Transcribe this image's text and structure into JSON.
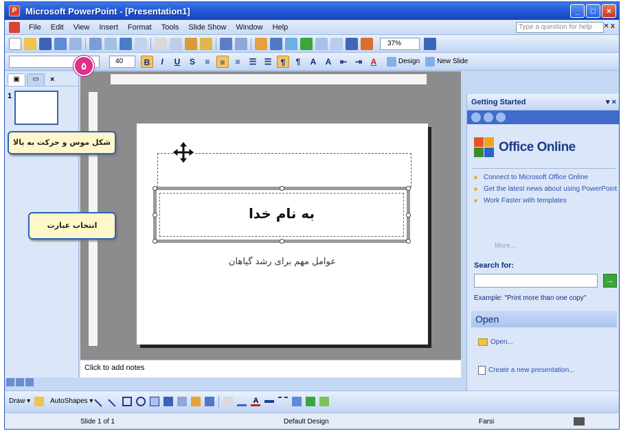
{
  "window": {
    "title": "Microsoft PowerPoint - [Presentation1]",
    "app_icon_letter": "P"
  },
  "menubar": {
    "items": [
      "File",
      "Edit",
      "View",
      "Insert",
      "Format",
      "Tools",
      "Slide Show",
      "Window",
      "Help"
    ],
    "help_placeholder": "Type a question for help",
    "close_label": "× x"
  },
  "toolbar": {
    "zoom_value": "37%",
    "font_size": "40",
    "design_label": "Design",
    "new_slide_label": "New Slide"
  },
  "left_pane": {
    "slide_number": "1"
  },
  "slide": {
    "title_text": "به نام خدا",
    "subtitle_text": "عوامل مهم برای رشد گیاهان",
    "step_badge": "۵"
  },
  "callouts": {
    "move_shape": "شکل موس و حرکت به بالا",
    "select_phrase": "انتخاب عبارت"
  },
  "notes": {
    "placeholder": "Click to add notes"
  },
  "task_pane": {
    "header": "Getting Started",
    "brand": "Office Online",
    "links": [
      "Connect to Microsoft Office Online",
      "Get the latest news about using PowerPoint",
      "Work Faster with templates"
    ],
    "more": "More...",
    "search_label": "Search for:",
    "search_example": "Example: \"Print more than one copy\"",
    "open_header": "Open",
    "open_link": "Open...",
    "create_link": "Create a new presentation..."
  },
  "drawbar": {
    "draw_label": "Draw ▾",
    "autoshapes_label": "AutoShapes ▾"
  },
  "statusbar": {
    "slide_info": "Slide 1 of 1",
    "design": "Default Design",
    "language": "Farsi"
  }
}
